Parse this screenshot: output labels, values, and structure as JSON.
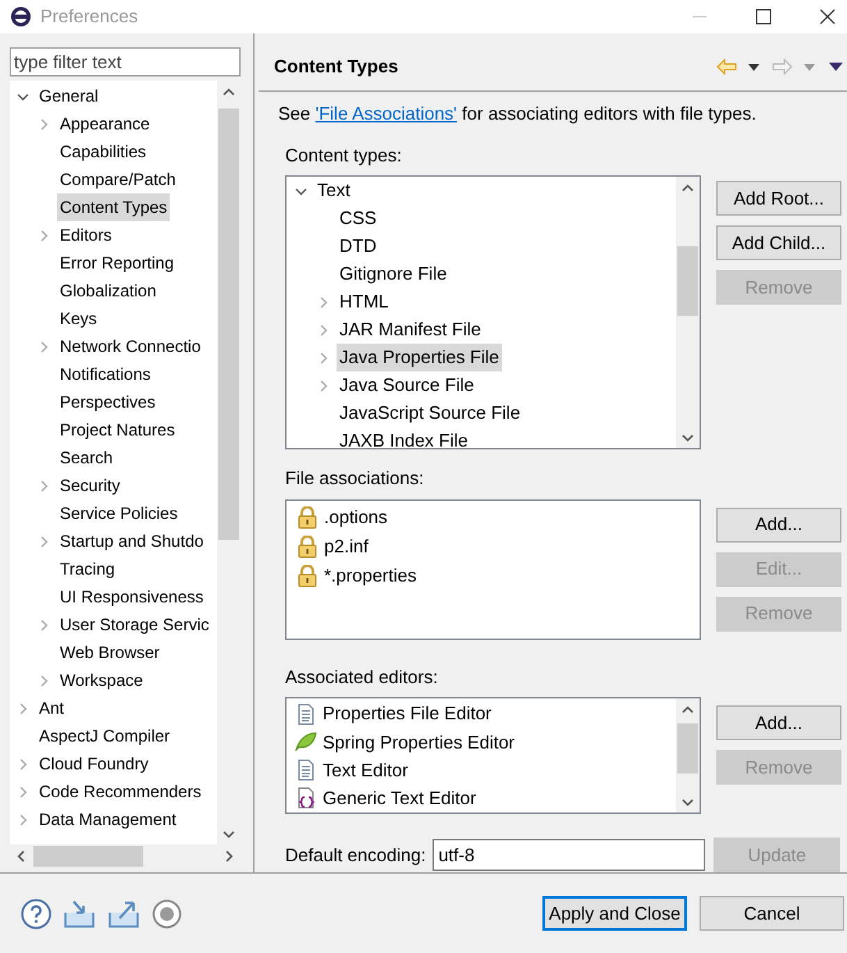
{
  "window": {
    "title": "Preferences"
  },
  "filter": {
    "placeholder": "type filter text"
  },
  "nav": [
    {
      "label": "General",
      "has_children": true,
      "expanded": true,
      "selected": false,
      "children": [
        {
          "label": "Appearance",
          "has_children": true,
          "expanded": false,
          "selected": false
        },
        {
          "label": "Capabilities",
          "has_children": false,
          "selected": false
        },
        {
          "label": "Compare/Patch",
          "has_children": false,
          "selected": false
        },
        {
          "label": "Content Types",
          "has_children": false,
          "selected": true
        },
        {
          "label": "Editors",
          "has_children": true,
          "expanded": false,
          "selected": false
        },
        {
          "label": "Error Reporting",
          "has_children": false,
          "selected": false
        },
        {
          "label": "Globalization",
          "has_children": false,
          "selected": false
        },
        {
          "label": "Keys",
          "has_children": false,
          "selected": false
        },
        {
          "label": "Network Connectio",
          "has_children": true,
          "expanded": false,
          "selected": false
        },
        {
          "label": "Notifications",
          "has_children": false,
          "selected": false
        },
        {
          "label": "Perspectives",
          "has_children": false,
          "selected": false
        },
        {
          "label": "Project Natures",
          "has_children": false,
          "selected": false
        },
        {
          "label": "Search",
          "has_children": false,
          "selected": false
        },
        {
          "label": "Security",
          "has_children": true,
          "expanded": false,
          "selected": false
        },
        {
          "label": "Service Policies",
          "has_children": false,
          "selected": false
        },
        {
          "label": "Startup and Shutdo",
          "has_children": true,
          "expanded": false,
          "selected": false
        },
        {
          "label": "Tracing",
          "has_children": false,
          "selected": false
        },
        {
          "label": "UI Responsiveness",
          "has_children": false,
          "selected": false
        },
        {
          "label": "User Storage Servic",
          "has_children": true,
          "expanded": false,
          "selected": false
        },
        {
          "label": "Web Browser",
          "has_children": false,
          "selected": false
        },
        {
          "label": "Workspace",
          "has_children": true,
          "expanded": false,
          "selected": false
        }
      ]
    },
    {
      "label": "Ant",
      "has_children": true,
      "expanded": false,
      "selected": false
    },
    {
      "label": "AspectJ Compiler",
      "has_children": false,
      "selected": false
    },
    {
      "label": "Cloud Foundry",
      "has_children": true,
      "expanded": false,
      "selected": false
    },
    {
      "label": "Code Recommenders",
      "has_children": true,
      "expanded": false,
      "selected": false
    },
    {
      "label": "Data Management",
      "has_children": true,
      "expanded": false,
      "selected": false
    }
  ],
  "page": {
    "title": "Content Types",
    "intro": {
      "before": "See ",
      "link": "'File Associations'",
      "after": " for associating editors with file types."
    },
    "content_types": {
      "label": "Content types:",
      "items": [
        {
          "label": "Text",
          "has_children": true,
          "expanded": true,
          "selected": false,
          "children": [
            {
              "label": "CSS",
              "has_children": false,
              "selected": false
            },
            {
              "label": "DTD",
              "has_children": false,
              "selected": false
            },
            {
              "label": "Gitignore File",
              "has_children": false,
              "selected": false
            },
            {
              "label": "HTML",
              "has_children": true,
              "expanded": false,
              "selected": false
            },
            {
              "label": "JAR Manifest File",
              "has_children": true,
              "expanded": false,
              "selected": false
            },
            {
              "label": "Java Properties File",
              "has_children": true,
              "expanded": false,
              "selected": true
            },
            {
              "label": "Java Source File",
              "has_children": true,
              "expanded": false,
              "selected": false
            },
            {
              "label": "JavaScript Source File",
              "has_children": false,
              "selected": false
            },
            {
              "label": "JAXB Index File",
              "has_children": false,
              "selected": false
            }
          ]
        }
      ],
      "buttons": [
        {
          "label": "Add Root...",
          "disabled": false
        },
        {
          "label": "Add Child...",
          "disabled": false
        },
        {
          "label": "Remove",
          "disabled": true
        }
      ]
    },
    "file_associations": {
      "label": "File associations:",
      "items": [
        {
          "label": ".options",
          "locked": true
        },
        {
          "label": "p2.inf",
          "locked": true
        },
        {
          "label": "*.properties",
          "locked": true
        }
      ],
      "buttons": [
        {
          "label": "Add...",
          "disabled": false
        },
        {
          "label": "Edit...",
          "disabled": true
        },
        {
          "label": "Remove",
          "disabled": true
        }
      ]
    },
    "associated_editors": {
      "label": "Associated editors:",
      "items": [
        {
          "label": "Properties File Editor",
          "kind": "document"
        },
        {
          "label": "Spring Properties Editor",
          "kind": "leaf"
        },
        {
          "label": "Text Editor",
          "kind": "document"
        },
        {
          "label": "Generic Text Editor",
          "kind": "generic"
        }
      ],
      "buttons": [
        {
          "label": "Add...",
          "disabled": false
        },
        {
          "label": "Remove",
          "disabled": true
        }
      ]
    },
    "encoding": {
      "label": "Default encoding:",
      "value": "utf-8",
      "button": {
        "label": "Update",
        "disabled": true
      }
    }
  },
  "footer": {
    "buttons": [
      {
        "label": "Apply and Close",
        "default": true
      },
      {
        "label": "Cancel",
        "default": false
      }
    ]
  }
}
